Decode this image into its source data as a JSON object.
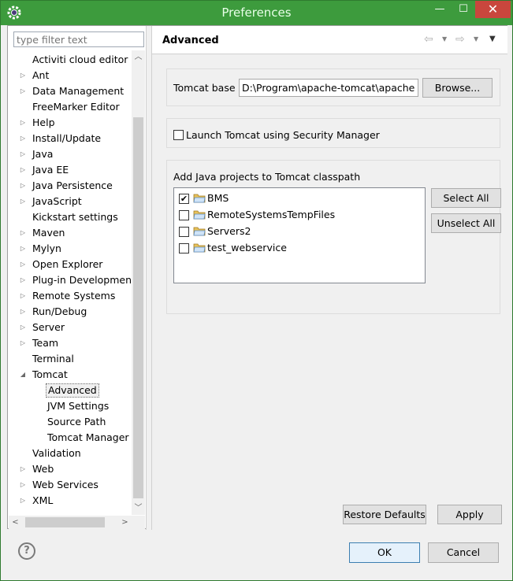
{
  "window": {
    "title": "Preferences",
    "controls": {
      "minimize": "—",
      "maximize": "☐",
      "close": "✕"
    }
  },
  "filter": {
    "placeholder": "type filter text"
  },
  "tree": [
    {
      "label": "Activiti cloud editor",
      "level": 0,
      "expandable": false
    },
    {
      "label": "Ant",
      "level": 0,
      "expandable": true
    },
    {
      "label": "Data Management",
      "level": 0,
      "expandable": true
    },
    {
      "label": "FreeMarker Editor",
      "level": 0,
      "expandable": false
    },
    {
      "label": "Help",
      "level": 0,
      "expandable": true
    },
    {
      "label": "Install/Update",
      "level": 0,
      "expandable": true
    },
    {
      "label": "Java",
      "level": 0,
      "expandable": true
    },
    {
      "label": "Java EE",
      "level": 0,
      "expandable": true
    },
    {
      "label": "Java Persistence",
      "level": 0,
      "expandable": true
    },
    {
      "label": "JavaScript",
      "level": 0,
      "expandable": true
    },
    {
      "label": "Kickstart settings",
      "level": 0,
      "expandable": false
    },
    {
      "label": "Maven",
      "level": 0,
      "expandable": true
    },
    {
      "label": "Mylyn",
      "level": 0,
      "expandable": true
    },
    {
      "label": "Open Explorer",
      "level": 0,
      "expandable": true
    },
    {
      "label": "Plug-in Development",
      "level": 0,
      "expandable": true
    },
    {
      "label": "Remote Systems",
      "level": 0,
      "expandable": true
    },
    {
      "label": "Run/Debug",
      "level": 0,
      "expandable": true
    },
    {
      "label": "Server",
      "level": 0,
      "expandable": true
    },
    {
      "label": "Team",
      "level": 0,
      "expandable": true
    },
    {
      "label": "Terminal",
      "level": 0,
      "expandable": false
    },
    {
      "label": "Tomcat",
      "level": 0,
      "expandable": true,
      "expanded": true
    },
    {
      "label": "Advanced",
      "level": 1,
      "expandable": false,
      "selected": true
    },
    {
      "label": "JVM Settings",
      "level": 1,
      "expandable": false
    },
    {
      "label": "Source Path",
      "level": 1,
      "expandable": false
    },
    {
      "label": "Tomcat Manager App",
      "level": 1,
      "expandable": false
    },
    {
      "label": "Validation",
      "level": 0,
      "expandable": false
    },
    {
      "label": "Web",
      "level": 0,
      "expandable": true
    },
    {
      "label": "Web Services",
      "level": 0,
      "expandable": true
    },
    {
      "label": "XML",
      "level": 0,
      "expandable": true
    }
  ],
  "page": {
    "title": "Advanced",
    "tomcat_base_label": "Tomcat base",
    "tomcat_base_value": "D:\\Program\\apache-tomcat\\apache-tomcat",
    "browse_label": "Browse...",
    "security_manager_label": "Launch Tomcat using Security Manager",
    "security_manager_checked": false,
    "classpath_label": "Add Java projects to Tomcat classpath",
    "projects": [
      {
        "name": "BMS",
        "checked": true
      },
      {
        "name": "RemoteSystemsTempFiles",
        "checked": false
      },
      {
        "name": "Servers2",
        "checked": false
      },
      {
        "name": "test_webservice",
        "checked": false
      }
    ],
    "select_all_label": "Select All",
    "unselect_all_label": "Unselect All",
    "restore_defaults_label": "Restore Defaults",
    "apply_label": "Apply"
  },
  "footer": {
    "help_glyph": "?",
    "ok_label": "OK",
    "cancel_label": "Cancel"
  },
  "colors": {
    "titlebar": "#3d9b3d",
    "close_button": "#c9463d",
    "folder": "#e8c25a"
  }
}
